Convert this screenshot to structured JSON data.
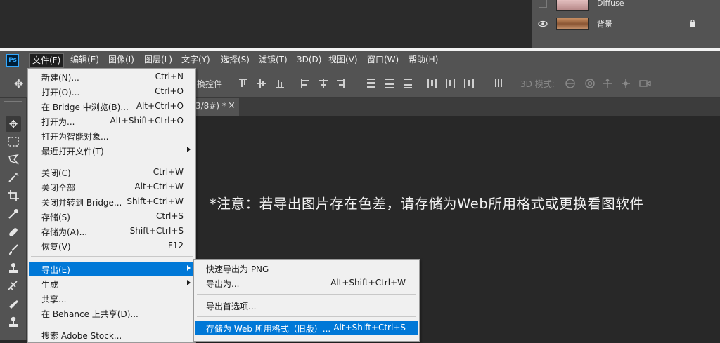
{
  "layers_panel": {
    "layers": [
      {
        "name": "Diffuse",
        "visible": false,
        "thumb": "pink-texture"
      },
      {
        "name": "背景",
        "visible": true,
        "locked": true,
        "thumb": "wood-texture"
      }
    ]
  },
  "menubar": {
    "app_icon": "Ps",
    "items": [
      "文件(F)",
      "编辑(E)",
      "图像(I)",
      "图层(L)",
      "文字(Y)",
      "选择(S)",
      "滤镜(T)",
      "3D(D)",
      "视图(V)",
      "窗口(W)",
      "帮助(H)"
    ],
    "active_index": 0
  },
  "options_bar": {
    "label": "换控件",
    "mode_3d": "3D 模式:"
  },
  "document_tab": {
    "label": "3/8#) *",
    "close": "×"
  },
  "file_menu": {
    "items": [
      {
        "label": "新建(N)...",
        "shortcut": "Ctrl+N"
      },
      {
        "label": "打开(O)...",
        "shortcut": "Ctrl+O"
      },
      {
        "label": "在 Bridge 中浏览(B)...",
        "shortcut": "Alt+Ctrl+O"
      },
      {
        "label": "打开为...",
        "shortcut": "Alt+Shift+Ctrl+O"
      },
      {
        "label": "打开为智能对象...",
        "shortcut": ""
      },
      {
        "label": "最近打开文件(T)",
        "shortcut": "",
        "submenu": true
      },
      {
        "label": "关闭(C)",
        "shortcut": "Ctrl+W"
      },
      {
        "label": "关闭全部",
        "shortcut": "Alt+Ctrl+W"
      },
      {
        "label": "关闭并转到 Bridge...",
        "shortcut": "Shift+Ctrl+W"
      },
      {
        "label": "存储(S)",
        "shortcut": "Ctrl+S"
      },
      {
        "label": "存储为(A)...",
        "shortcut": "Shift+Ctrl+S"
      },
      {
        "label": "恢复(V)",
        "shortcut": "F12"
      },
      {
        "label": "导出(E)",
        "shortcut": "",
        "submenu": true,
        "highlighted": true
      },
      {
        "label": "生成",
        "shortcut": "",
        "submenu": true
      },
      {
        "label": "共享...",
        "shortcut": ""
      },
      {
        "label": "在 Behance 上共享(D)...",
        "shortcut": ""
      },
      {
        "label": "搜索 Adobe Stock...",
        "shortcut": ""
      }
    ]
  },
  "export_menu": {
    "items": [
      {
        "label": "快速导出为 PNG",
        "shortcut": ""
      },
      {
        "label": "导出为...",
        "shortcut": "Alt+Shift+Ctrl+W"
      },
      {
        "label": "导出首选项...",
        "shortcut": ""
      },
      {
        "label": "存储为 Web 所用格式（旧版）...",
        "shortcut": "Alt+Shift+Ctrl+S",
        "highlighted": true
      }
    ]
  },
  "notice": "*注意：若导出图片存在色差，请存储为Web所用格式或更换看图软件",
  "colors": {
    "menu_highlight": "#0078d7",
    "ui_panel": "#535353",
    "canvas": "#282828"
  }
}
